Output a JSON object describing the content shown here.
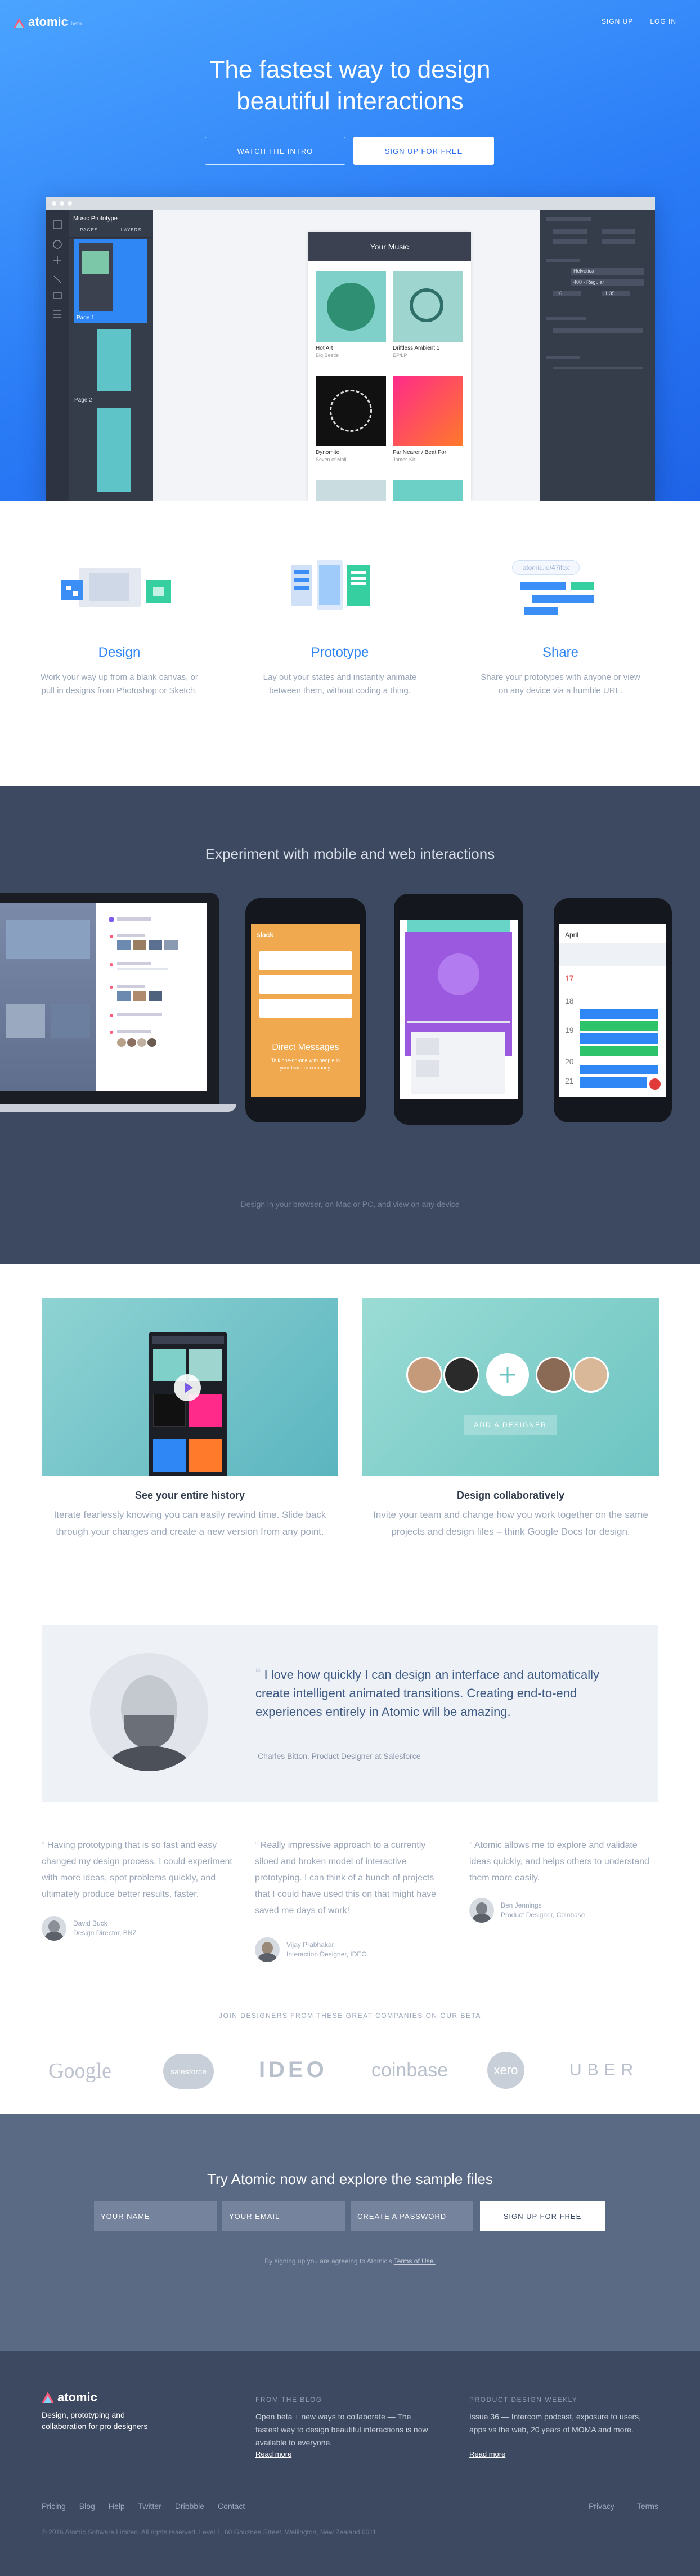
{
  "brand": {
    "name": "atomic",
    "beta": "beta"
  },
  "nav": {
    "signup": "SIGN UP",
    "login": "LOG IN"
  },
  "hero": {
    "title_line1": "The fastest way to design",
    "title_line2": "beautiful interactions",
    "watch_label": "WATCH THE INTRO",
    "signup_label": "SIGN UP FOR FREE"
  },
  "app_mock": {
    "project": "Music Prototype",
    "tabs": [
      "PAGES",
      "LAYERS"
    ],
    "pages": [
      "Page 1",
      "Page 2"
    ],
    "screen_title": "Your Music",
    "albums": [
      {
        "title": "Hot Art",
        "artist": "Big Beetle"
      },
      {
        "title": "Driftless Ambient 1",
        "artist": "EP/LP"
      },
      {
        "title": "Dynomite",
        "artist": "Seven of Mall"
      },
      {
        "title": "Far Nearer / Beat For",
        "artist": "James Kit"
      }
    ],
    "inspector": {
      "font": "Helvetica",
      "weight": "400 - Regular",
      "size": "16",
      "line": "1.35"
    }
  },
  "features": [
    {
      "title": "Design",
      "text": "Work your way up from a blank canvas, or pull in designs from Photoshop or Sketch."
    },
    {
      "title": "Prototype",
      "text": "Lay out your states and instantly animate between them, without coding a thing."
    },
    {
      "title": "Share",
      "text": "Share your prototypes with anyone or view on any device via a humble URL."
    }
  ],
  "share_url": "atomic.io/47ifcx",
  "experiment": {
    "title": "Experiment with mobile and web interactions",
    "subtitle": "Design in your browser, on Mac or PC, and view on any device",
    "slack": {
      "brand": "slack",
      "headline": "Direct Messages",
      "body": "Talk one-on-one with people in your team or company."
    },
    "calendar": {
      "month": "April",
      "days": [
        "17",
        "18",
        "19",
        "20",
        "21"
      ]
    }
  },
  "history": [
    {
      "title": "See your entire history",
      "text": "Iterate fearlessly knowing you can easily rewind time. Slide back through your changes and create a new version from any point."
    },
    {
      "title": "Design collaboratively",
      "text": "Invite your team and change how you work together on the same projects and design files – think Google Docs for design."
    }
  ],
  "add_designer": "ADD A DESIGNER",
  "testimonial_main": {
    "quote": "I love how quickly I can design an interface and automatically create intelligent animated transitions. Creating end-to-end experiences entirely in Atomic will be amazing.",
    "by": "Charles Bitton, Product Designer at Salesforce"
  },
  "testimonials": [
    {
      "quote": "Having prototyping that is so fast and easy changed my design process. I could experiment with more ideas, spot problems quickly, and ultimately produce better results, faster.",
      "name": "David Buck",
      "role": "Design Director, BNZ"
    },
    {
      "quote": "Really impressive approach to a currently siloed and broken model of interactive prototyping. I can think of a bunch of projects that I could have used this on that might have saved me days of work!",
      "name": "Vijay Prabhakar",
      "role": "Interaction Designer, IDEO"
    },
    {
      "quote": "Atomic allows me to explore and validate ideas quickly, and helps others to understand them more easily.",
      "name": "Ben Jennings",
      "role": "Product Designer, Coinbase"
    }
  ],
  "beta_title": "JOIN DESIGNERS FROM THESE GREAT COMPANIES ON OUR BETA",
  "companies": [
    "Google",
    "salesforce",
    "IDEO",
    "coinbase",
    "xero",
    "UBER"
  ],
  "try": {
    "title": "Try Atomic now and explore the sample files",
    "name_ph": "YOUR NAME",
    "email_ph": "YOUR EMAIL",
    "password_ph": "CREATE A PASSWORD",
    "button": "SIGN UP FOR FREE",
    "note_prefix": "By signing up you are agreeing to Atomic's ",
    "note_link": "Terms of Use."
  },
  "footer": {
    "tagline": "Design, prototyping and collaboration for pro designers",
    "blog_title": "FROM THE BLOG",
    "blog_text": "Open beta + new ways to collaborate — The fastest way to design beautiful interactions is now available to everyone.",
    "blog_link": "Read more",
    "weekly_title": "PRODUCT DESIGN WEEKLY",
    "weekly_text": "Issue 36 — Intercom podcast, exposure to users, apps vs the web, 20 years of MOMA and more.",
    "weekly_link": "Read more",
    "links": [
      "Pricing",
      "Blog",
      "Help",
      "Twitter",
      "Dribbble",
      "Contact"
    ],
    "right_links": [
      "Privacy",
      "Terms"
    ],
    "copyright": "© 2016 Atomic Software Limited. All rights reserved. Level 1, 60 Ghuznee Street, Wellington, New Zealand 6011"
  },
  "colors": {
    "accent": "#2f86f5",
    "dark": "#3c4960",
    "hero": "#2a7bf6"
  }
}
